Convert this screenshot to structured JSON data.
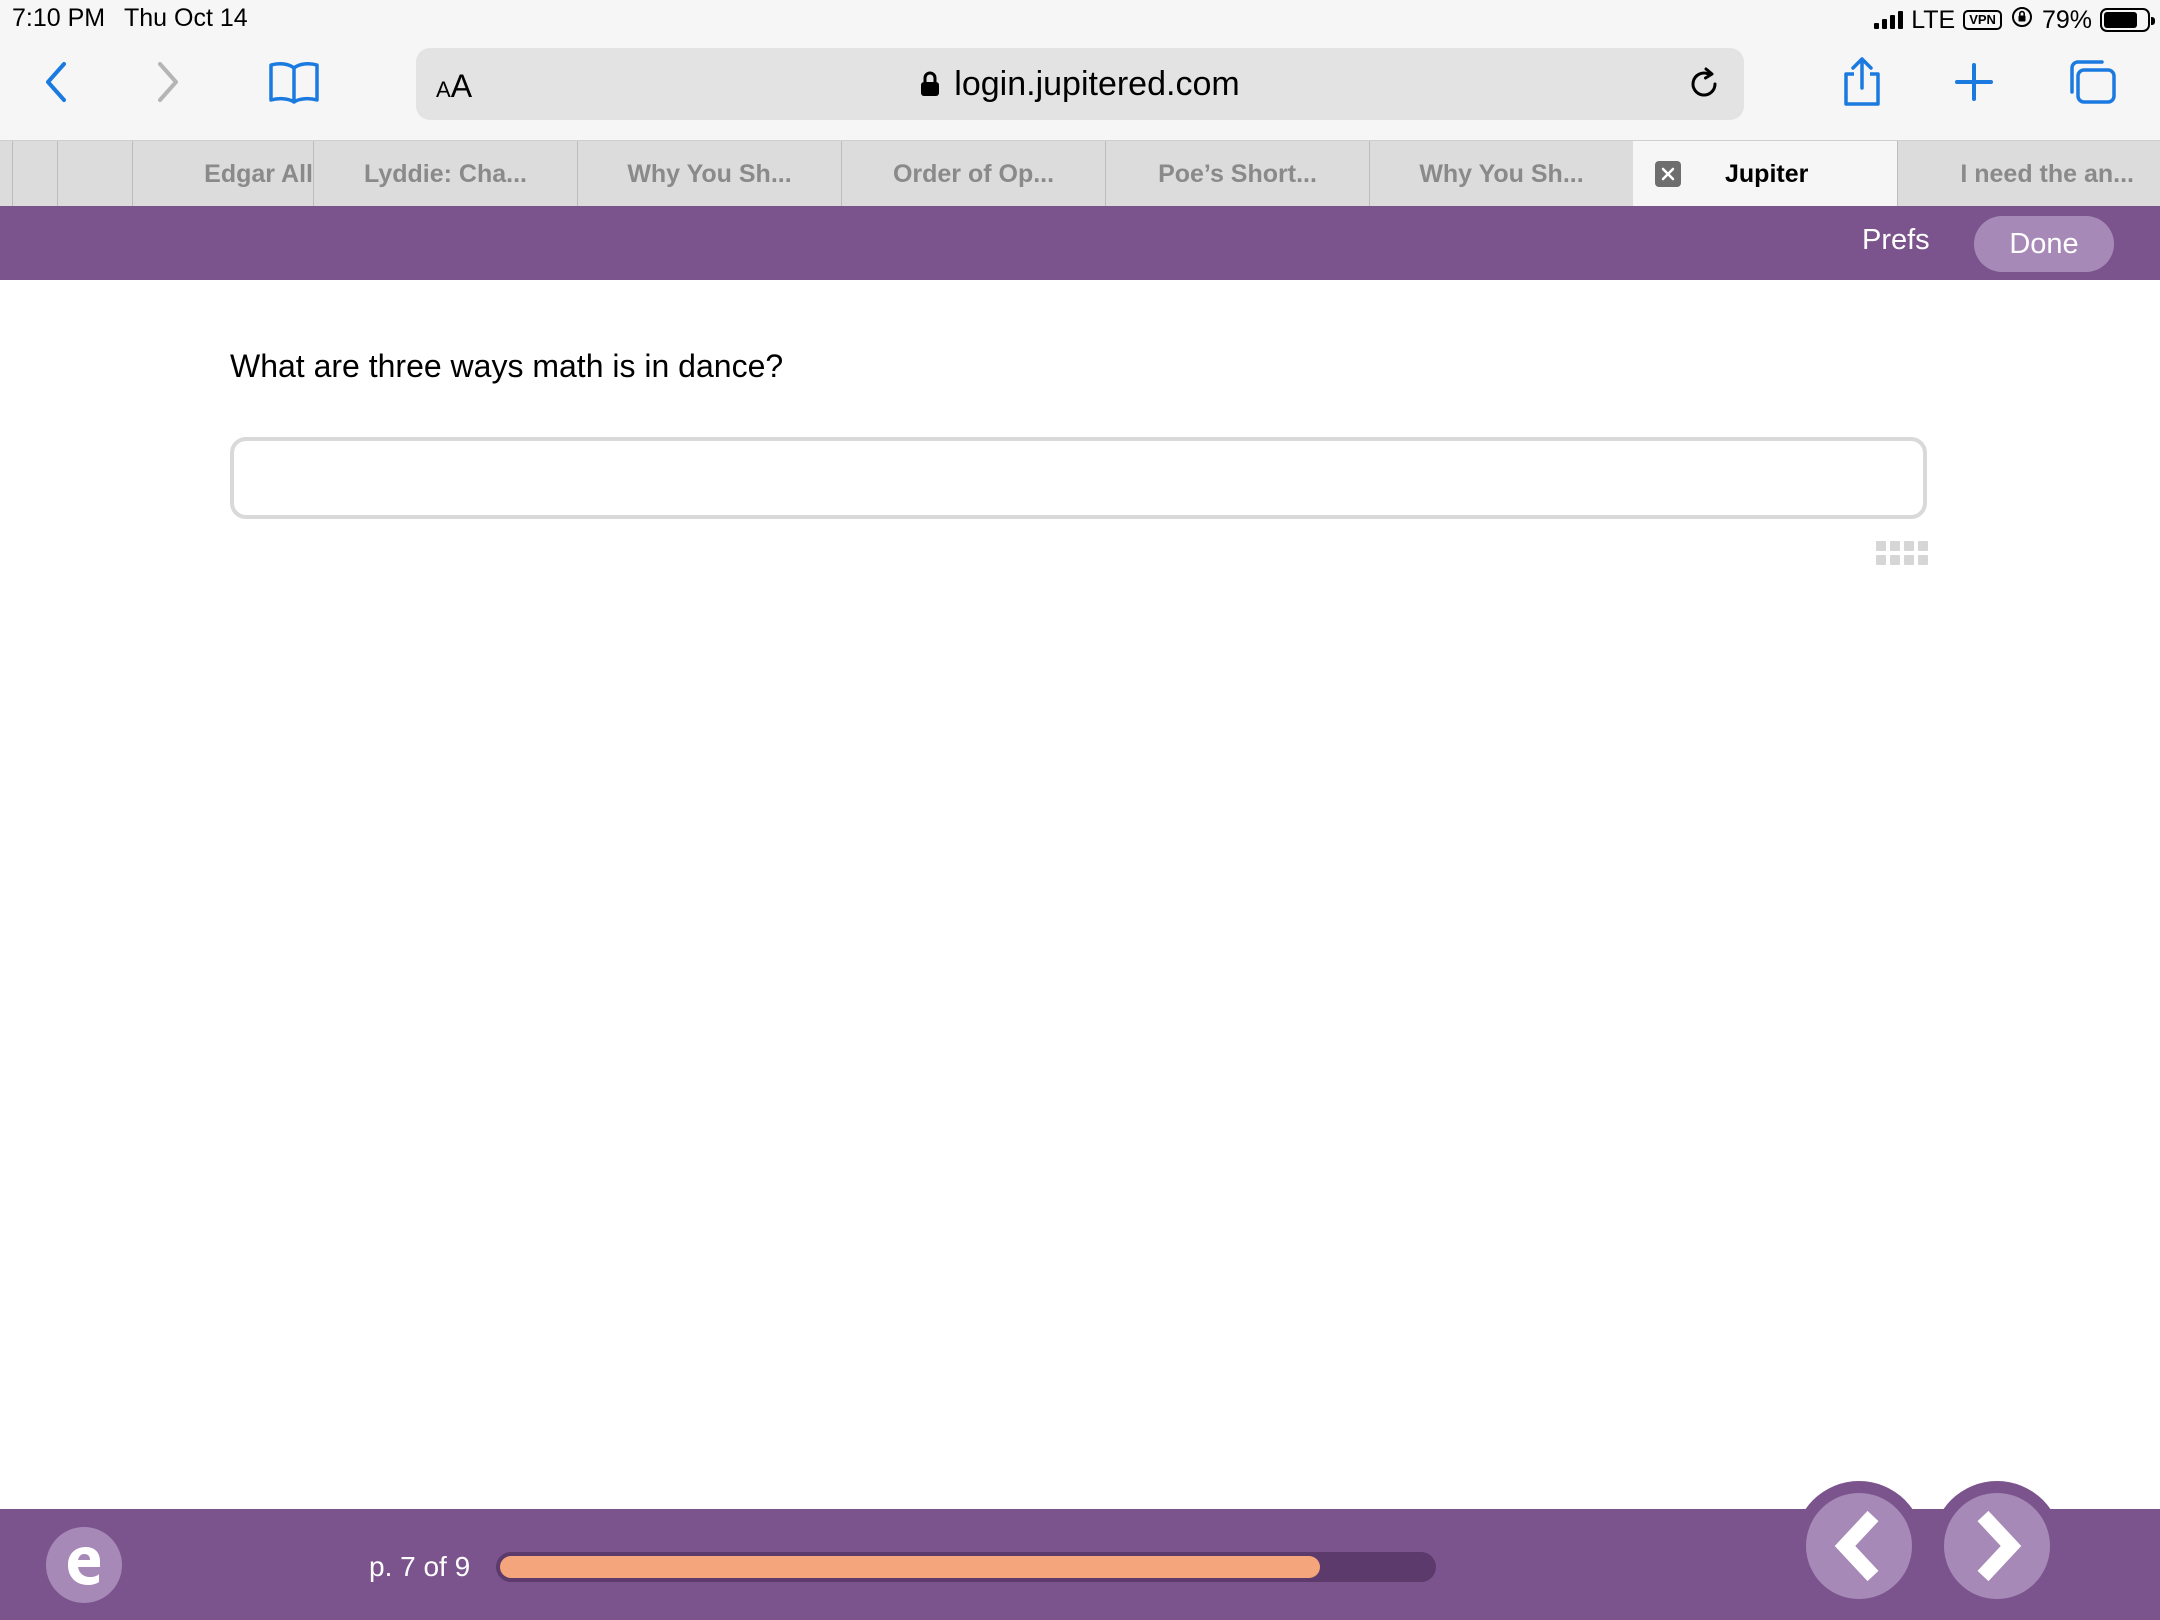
{
  "status_bar": {
    "time": "7:10 PM",
    "date": "Thu Oct 14",
    "network": "LTE",
    "vpn": "VPN",
    "battery": "79%",
    "battery_level": 0.79
  },
  "browser": {
    "text_size_small": "A",
    "text_size_large": "A",
    "url": "login.jupitered.com"
  },
  "tabs": [
    {
      "label": "Edgar All",
      "active": false
    },
    {
      "label": "Lyddie: Cha...",
      "active": false
    },
    {
      "label": "Why You Sh...",
      "active": false
    },
    {
      "label": "Order of Op...",
      "active": false
    },
    {
      "label": "Poe’s Short...",
      "active": false
    },
    {
      "label": "Why You Sh...",
      "active": false
    },
    {
      "label": "Jupiter",
      "active": true
    },
    {
      "label": "I need the an...",
      "active": false
    }
  ],
  "header": {
    "prefs_label": "Prefs",
    "done_label": "Done",
    "color": "#7b548d"
  },
  "main": {
    "question": "What are three ways math is in dance?",
    "answer_value": ""
  },
  "footer": {
    "page_indicator": "p. 7 of 9",
    "progress": 0.88,
    "progress_color": "#f4a57b"
  }
}
